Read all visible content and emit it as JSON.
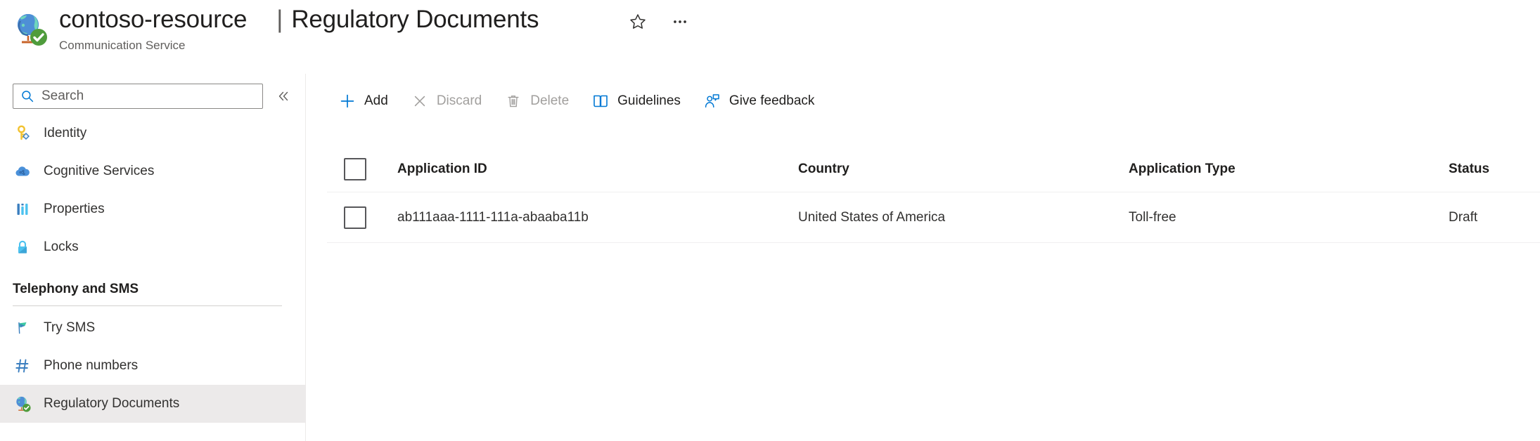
{
  "header": {
    "resource_icon": "globe-check-icon",
    "resource_name": "contoso-resource",
    "separator": "|",
    "page_title": "Regulatory Documents",
    "subtitle": "Communication Service",
    "favorite_icon": "star-outline-icon",
    "more_icon": "ellipsis-icon"
  },
  "sidebar": {
    "search": {
      "placeholder": "Search",
      "value": "",
      "icon": "search-icon"
    },
    "collapse_icon": "double-chevron-left-icon",
    "items": [
      {
        "label": "Identity",
        "icon": "key-icon",
        "selected": false
      },
      {
        "label": "Cognitive Services",
        "icon": "cloud-icon",
        "selected": false
      },
      {
        "label": "Properties",
        "icon": "properties-bars-icon",
        "selected": false
      },
      {
        "label": "Locks",
        "icon": "lock-icon",
        "selected": false
      }
    ],
    "section_title": "Telephony and SMS",
    "section_items": [
      {
        "label": "Try SMS",
        "icon": "flag-icon",
        "selected": false
      },
      {
        "label": "Phone numbers",
        "icon": "hash-icon",
        "selected": false
      },
      {
        "label": "Regulatory Documents",
        "icon": "globe-check-icon",
        "selected": true
      }
    ]
  },
  "toolbar": [
    {
      "label": "Add",
      "icon": "plus-icon",
      "disabled": false
    },
    {
      "label": "Discard",
      "icon": "cancel-x-icon",
      "disabled": true
    },
    {
      "label": "Delete",
      "icon": "trash-icon",
      "disabled": true
    },
    {
      "label": "Guidelines",
      "icon": "book-icon",
      "disabled": false
    },
    {
      "label": "Give feedback",
      "icon": "person-feedback-icon",
      "disabled": false
    }
  ],
  "table": {
    "select_all_checked": false,
    "columns": [
      "Application ID",
      "Country",
      "Application Type",
      "Status"
    ],
    "rows": [
      {
        "checked": false,
        "application_id": "ab111aaa-1111-111a-abaaba11b",
        "country": "United States of America",
        "application_type": "Toll-free",
        "status": "Draft"
      }
    ]
  },
  "colors": {
    "accent_blue": "#0078d4",
    "selected_nav_bg": "#eceaea",
    "disabled_text": "#a19f9d",
    "text_primary": "#201f1e",
    "text_secondary": "#605e5c"
  }
}
